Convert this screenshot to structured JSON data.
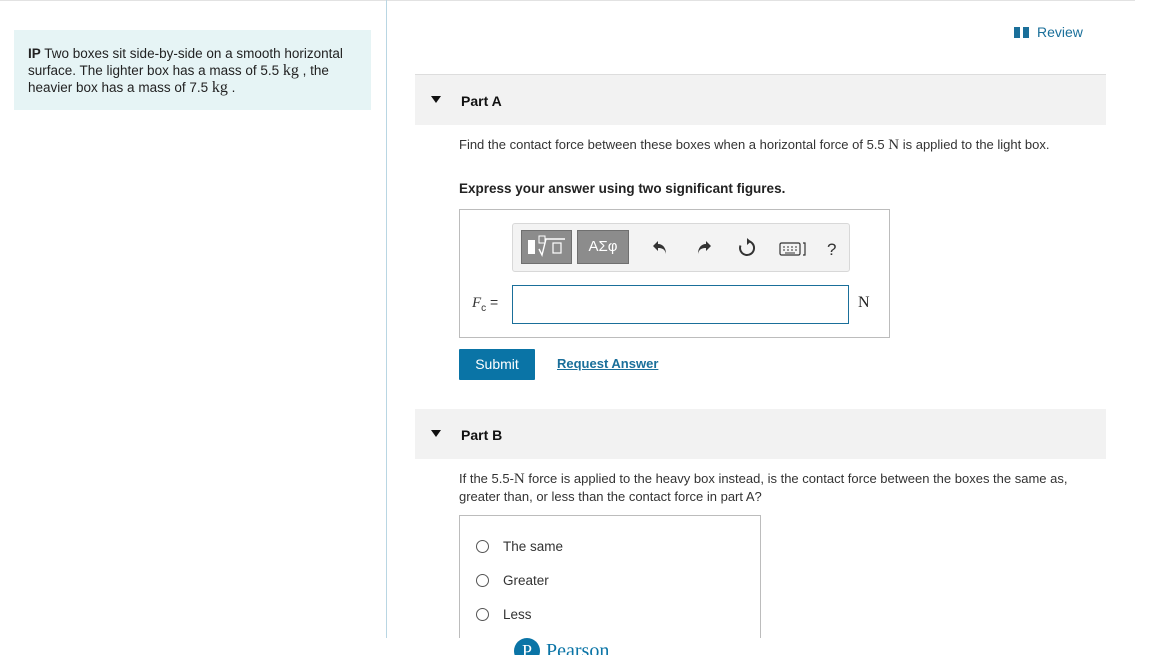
{
  "problem": {
    "prefix": "IP",
    "t1": " Two boxes sit side-by-side on a smooth horizontal surface. The lighter box has a mass of 5.5 ",
    "u1": "kg",
    "t2": " , the heavier box has a mass of 7.5 ",
    "u2": "kg",
    "t3": " ."
  },
  "review": {
    "label": "Review"
  },
  "partA": {
    "title": "Part A",
    "q1": "Find the contact force between these boxes when a horizontal force of 5.5 ",
    "qunit": "N",
    "q2": " is applied to the light box.",
    "instruction": "Express your answer using two significant figures.",
    "toolbar": {
      "symbols_label": "ΑΣφ",
      "help": "?"
    },
    "variable": "F",
    "subscript": "c",
    "equals": " =",
    "input_value": "",
    "unit": "N",
    "submit": "Submit",
    "request": "Request Answer"
  },
  "partB": {
    "title": "Part B",
    "q1": "If the 5.5-",
    "qunit": "N",
    "q2": " force is applied to the heavy box instead, is the contact force between the boxes the same as, greater than, or less than the contact force in part A?",
    "options": [
      "The same",
      "Greater",
      "Less"
    ]
  },
  "footer": {
    "logo_letter": "P",
    "logo_text": "Pearson"
  },
  "colors": {
    "accent": "#0a74a6",
    "panel_bg": "#e6f4f5",
    "header_bg": "#f2f2f2"
  }
}
